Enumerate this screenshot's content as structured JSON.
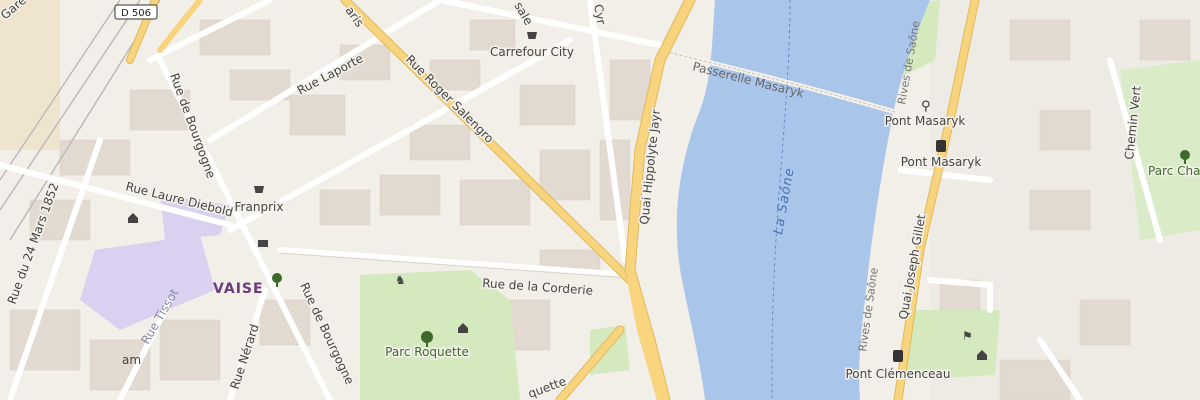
{
  "map": {
    "road_shield": "D 506",
    "district": "VAISE",
    "river": "La Saône",
    "streets": {
      "gare": "Gare",
      "rue_de_bourgogne_1": "Rue de Bourgogne",
      "rue_de_bourgogne_2": "Rue de Bourgogne",
      "rue_laporte": "Rue Laporte",
      "rue_roger_salengro": "Rue Roger Salengro",
      "rue_laure_diebold": "Rue Laure Diebold",
      "rue_du_24_mars": "Rue du 24 Mars 1852",
      "rue_de_la_corderie": "Rue de la Corderie",
      "quai_hippolyte_jayr": "Quai Hippolyte Jayr",
      "quai_joseph_gillet": "Quai Joseph Gillet",
      "passerelle_masaryk": "Passerelle Masaryk",
      "rives_de_saone_1": "Rives de Saône",
      "rives_de_saone_2": "Rives de Saône",
      "rue_tissot": "Rue Tissot",
      "rue_nerard": "Rue Nérard",
      "chemin_vert": "Chemin Vert",
      "partial_top_1": "aris",
      "partial_top_2": "sale",
      "partial_top_3": "Cyr",
      "partial_bottom": "quette",
      "partial_left": "am"
    },
    "pois": {
      "carrefour": "Carrefour City",
      "franprix": "Franprix",
      "pont_masaryk_bike": "Pont Masaryk",
      "pont_masaryk_bus": "Pont Masaryk",
      "parc_roquette": "Parc Roquette",
      "parc_chaz": "Parc Chaz",
      "pont_clemenceau": "Pont Clémenceau"
    },
    "colors": {
      "background": "#f2efe9",
      "water": "#a9c5ea",
      "park": "#d4e9bd",
      "primary_road": "#f7d47d",
      "minor_road": "#ffffff",
      "building": "#e3dbd1",
      "residential": "#e8e2dd",
      "district_fill": "#cfc3ec"
    }
  }
}
